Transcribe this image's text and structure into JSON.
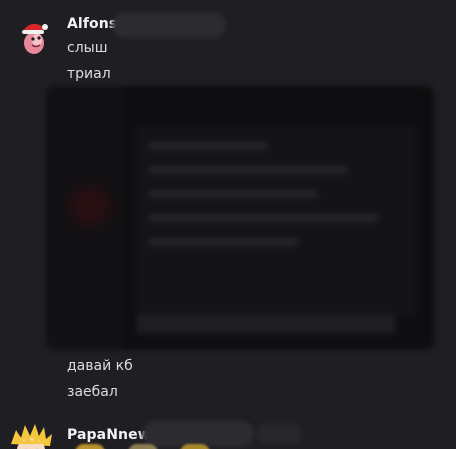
{
  "messages": [
    {
      "username": "Alfons",
      "lines": [
        "слыш",
        "триал"
      ],
      "attachment": "blurred-screenshot"
    },
    {
      "lines": [
        "давай кб",
        "заебал"
      ]
    },
    {
      "username": "PapaNnew"
    }
  ],
  "icons": {
    "avatar_1": "santa-worm-avatar-icon",
    "avatar_2": "blonde-anime-avatar-icon"
  },
  "colors": {
    "background": "#1f1f23",
    "username": "#f2f3f5",
    "message_text": "#dbdee1",
    "santa_red": "#d9252b",
    "worm_pink": "#e98a9a",
    "hair_yellow": "#f3c63c"
  }
}
